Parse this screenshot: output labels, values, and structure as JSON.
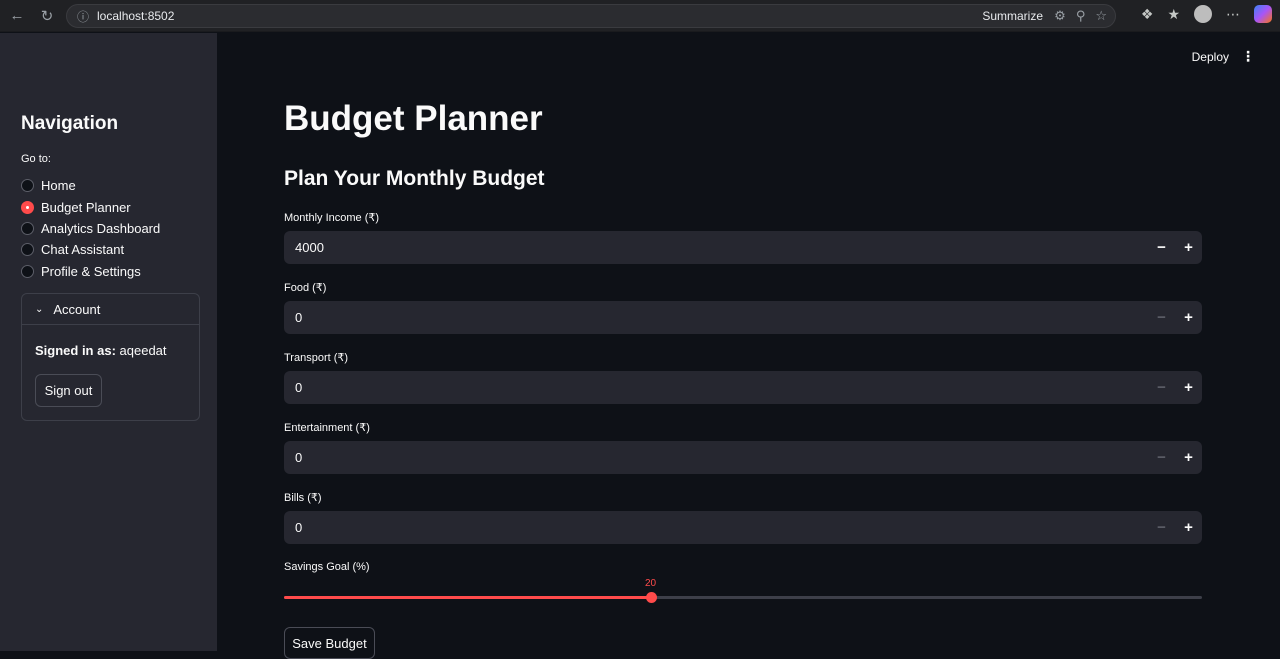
{
  "browser": {
    "url": "localhost:8502",
    "summarize_label": "Summarize"
  },
  "header": {
    "deploy_label": "Deploy"
  },
  "sidebar": {
    "title": "Navigation",
    "goto_label": "Go to:",
    "items": [
      {
        "label": "Home",
        "selected": false
      },
      {
        "label": "Budget Planner",
        "selected": true
      },
      {
        "label": "Analytics Dashboard",
        "selected": false
      },
      {
        "label": "Chat Assistant",
        "selected": false
      },
      {
        "label": "Profile & Settings",
        "selected": false
      }
    ],
    "account": {
      "header": "Account",
      "signed_in_prefix": "Signed in as:",
      "username": "aqeedat",
      "signout_label": "Sign out"
    }
  },
  "main": {
    "title": "Budget Planner",
    "subtitle": "Plan Your Monthly Budget",
    "fields": [
      {
        "label": "Monthly Income (₹)",
        "value": "4000"
      },
      {
        "label": "Food (₹)",
        "value": "0"
      },
      {
        "label": "Transport (₹)",
        "value": "0"
      },
      {
        "label": "Entertainment (₹)",
        "value": "0"
      },
      {
        "label": "Bills (₹)",
        "value": "0"
      }
    ],
    "savings": {
      "label": "Savings Goal (%)",
      "value": "20",
      "fraction": 0.4
    },
    "save_label": "Save Budget"
  },
  "colors": {
    "accent": "#ff4b4b",
    "sidebar_bg": "#262730",
    "main_bg": "#0e1117"
  }
}
